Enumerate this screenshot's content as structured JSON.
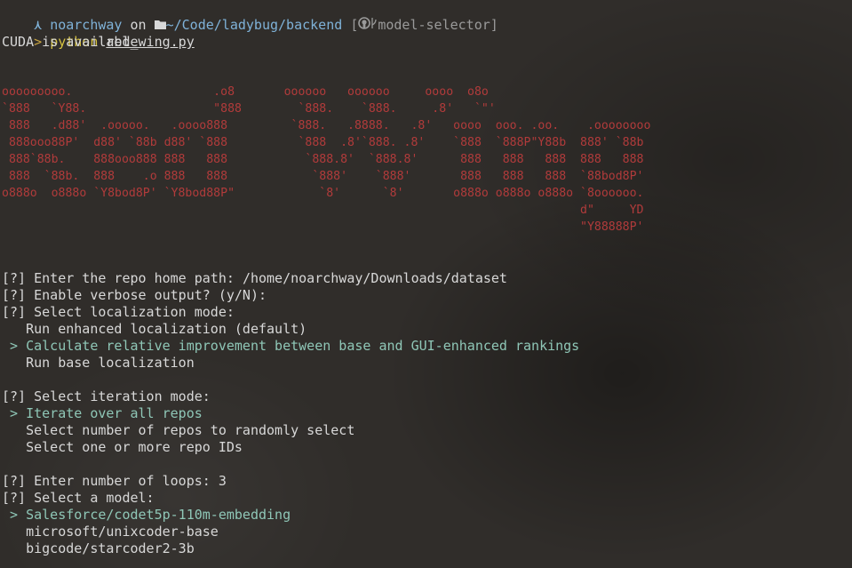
{
  "prompt": {
    "arrow": "⋏",
    "user": "noarchway",
    "on": "on",
    "path": "~/Code/ladybug/backend",
    "branch": "model-selector",
    "bracket_open": "[",
    "bracket_close": "]"
  },
  "command": {
    "gt": ">",
    "program": "python",
    "file": "red_wing.py"
  },
  "output": {
    "cuda": "CUDA is available",
    "banner": "ooooooooo.                    .o8       oooooo   oooooo     oooo  o8o\n`888   `Y88.                  \"888        `888.    `888.     .8'   `\"'\n 888   .d88'  .ooooo.   .oooo888         `888.   .8888.   .8'   oooo  ooo. .oo.    .oooooooo\n 888ooo88P'  d88' `88b d88' `888          `888  .8'`888. .8'    `888  `888P\"Y88b  888' `88b\n 888`88b.    888ooo888 888   888           `888.8'  `888.8'      888   888   888  888   888\n 888  `88b.  888    .o 888   888            `888'    `888'       888   888   888  `88bod8P'\no888o  o888o `Y8bod8P' `Y8bod88P\"            `8'      `8'       o888o o888o o888o `8oooooo.\n                                                                                  d\"     YD\n                                                                                  \"Y88888P'"
  },
  "questions": {
    "repo_path": {
      "mark": "[?]",
      "label": "Enter the repo home path:",
      "value": "/home/noarchway/Downloads/dataset"
    },
    "verbose": {
      "mark": "[?]",
      "label": "Enable verbose output? (y/N):"
    },
    "localization": {
      "mark": "[?]",
      "label": "Select localization mode:",
      "options": [
        "Run enhanced localization (default)",
        "Calculate relative improvement between base and GUI-enhanced rankings",
        "Run base localization"
      ],
      "selected_index": 1
    },
    "iteration": {
      "mark": "[?]",
      "label": "Select iteration mode:",
      "options": [
        "Iterate over all repos",
        "Select number of repos to randomly select",
        "Select one or more repo IDs"
      ],
      "selected_index": 0
    },
    "loops": {
      "mark": "[?]",
      "label": "Enter number of loops:",
      "value": "3"
    },
    "model": {
      "mark": "[?]",
      "label": "Select a model:",
      "options": [
        "Salesforce/codet5p-110m-embedding",
        "microsoft/unixcoder-base",
        "bigcode/starcoder2-3b"
      ],
      "selected_index": 0
    },
    "pointer": ">"
  },
  "colors": {
    "background": "#302d2a",
    "text": "#d8d8d8",
    "user": "#7fb2d8",
    "banner": "#b13b3b",
    "selected": "#8fc7b7",
    "python": "#d6c23f"
  }
}
